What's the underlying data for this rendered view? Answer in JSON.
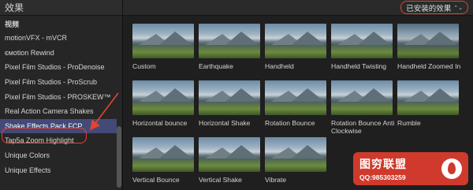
{
  "left": {
    "title": "效果",
    "category_header": "视频",
    "items": [
      "motionVFX - mVCR",
      "ємotion Rewind",
      "Pixel Film Studios - ProDenoise",
      "Pixel Film Studios - ProScrub",
      "Pixel Film Studios - PROSKEW™",
      "Real Action Camera Shakes",
      "Shake Effects Pack FCP",
      "Tap5a Zoom Highlight",
      "Unique Colors",
      "Unique Effects"
    ],
    "selected_index": 6
  },
  "right": {
    "filter_label": "已安装的效果",
    "effects": [
      "Custom",
      "Earthquake",
      "Handheld",
      "Handheld Twisting",
      "Handheld Zoomed In",
      "Horizontal bounce",
      "Horizontal Shake",
      "Rotation Bounce",
      "Rotation Bounce Anti Clockwise",
      "Rumble",
      "Vertical Bounce",
      "Vertical Shake",
      "Vibrate"
    ]
  },
  "watermark": {
    "title": "图穷联盟",
    "qq": "QQ:985303259"
  },
  "colors": {
    "accent_red": "#e5432f",
    "selection": "#434a78"
  }
}
